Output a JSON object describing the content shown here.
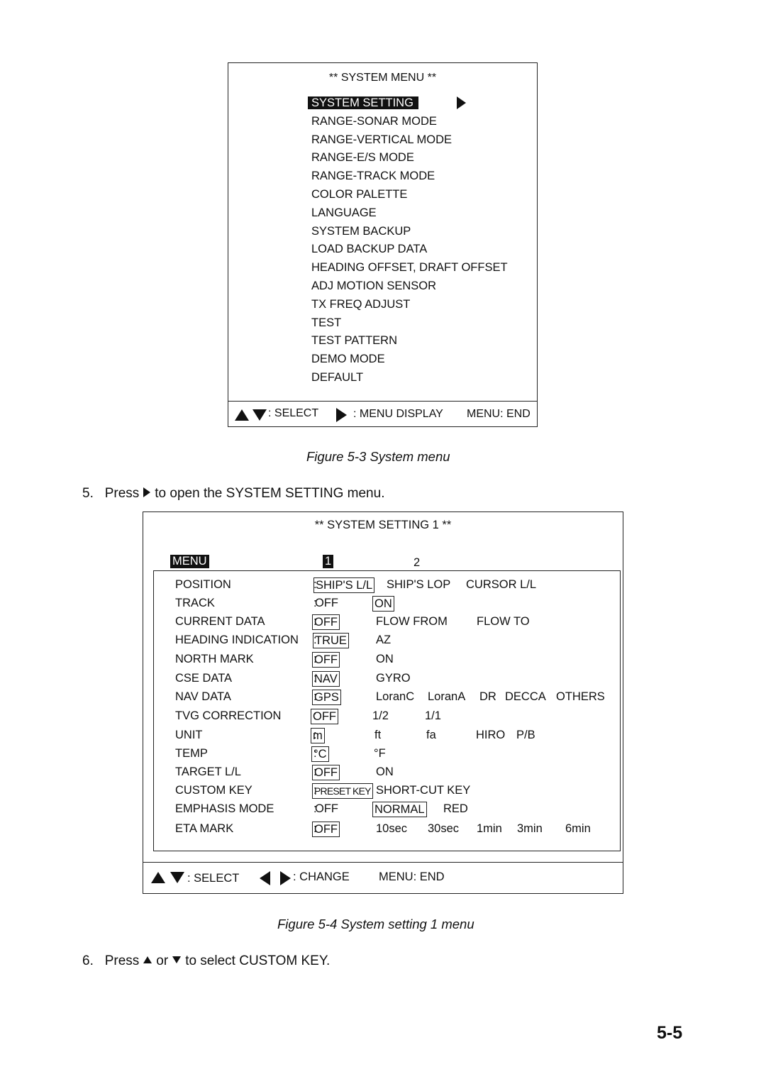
{
  "figure_5_3": {
    "title": "** SYSTEM MENU **",
    "items": [
      {
        "label": "SYSTEM SETTING",
        "selected": true
      },
      {
        "label": "RANGE-SONAR MODE"
      },
      {
        "label": "RANGE-VERTICAL MODE"
      },
      {
        "label": "RANGE-E/S MODE"
      },
      {
        "label": "RANGE-TRACK MODE"
      },
      {
        "label": "COLOR PALETTE"
      },
      {
        "label": "LANGUAGE"
      },
      {
        "label": "SYSTEM BACKUP"
      },
      {
        "label": "LOAD BACKUP DATA"
      },
      {
        "label": "HEADING OFFSET, DRAFT OFFSET"
      },
      {
        "label": "ADJ MOTION SENSOR"
      },
      {
        "label": "TX FREQ ADJUST"
      },
      {
        "label": "TEST"
      },
      {
        "label": "TEST PATTERN"
      },
      {
        "label": "DEMO MODE"
      },
      {
        "label": "DEFAULT"
      }
    ],
    "footer": {
      "select": ": SELECT",
      "menu_display": ": MENU DISPLAY",
      "menu_end": "MENU: END"
    },
    "caption": "Figure 5-3 System menu"
  },
  "step5": {
    "num": "5.",
    "pre": "Press",
    "post": "to open the SYSTEM SETTING menu."
  },
  "figure_5_4": {
    "title": "** SYSTEM SETTING 1 **",
    "tabs": {
      "menu": "MENU",
      "page1": "1",
      "page2": "2"
    },
    "rows": [
      {
        "label": "POSITION",
        "options": [
          "SHIP'S L/L",
          "SHIP'S LOP",
          "CURSOR L/L"
        ],
        "selected": 0
      },
      {
        "label": "TRACK",
        "options": [
          "OFF",
          "ON"
        ],
        "selected": 1
      },
      {
        "label": "CURRENT DATA",
        "options": [
          "OFF",
          "FLOW FROM",
          "FLOW TO"
        ],
        "selected": 0
      },
      {
        "label": "HEADING INDICATION",
        "options": [
          "TRUE",
          "AZ"
        ],
        "selected": 0
      },
      {
        "label": "NORTH MARK",
        "options": [
          "OFF",
          "ON"
        ],
        "selected": 0
      },
      {
        "label": "CSE DATA",
        "options": [
          "NAV",
          "GYRO"
        ],
        "selected": 0
      },
      {
        "label": "NAV DATA",
        "options": [
          "GPS",
          "LoranC",
          "LoranA",
          "DR",
          "DECCA",
          "OTHERS"
        ],
        "selected": 0
      },
      {
        "label": "TVG CORRECTION",
        "options": [
          "OFF",
          "1/2",
          "1/1"
        ],
        "selected": 0
      },
      {
        "label": "UNIT",
        "options": [
          "m",
          "ft",
          "fa",
          "HIRO",
          "P/B"
        ],
        "selected": 0
      },
      {
        "label": "TEMP",
        "options": [
          "°C",
          "°F"
        ],
        "selected": 0
      },
      {
        "label": "TARGET L/L",
        "options": [
          "OFF",
          "ON"
        ],
        "selected": 0
      },
      {
        "label": "CUSTOM KEY",
        "options": [
          "PRESET KEY",
          "SHORT-CUT KEY"
        ],
        "selected": 0
      },
      {
        "label": "EMPHASIS MODE",
        "options": [
          "OFF",
          "NORMAL",
          "RED"
        ],
        "selected": 1
      },
      {
        "label": "ETA MARK",
        "options": [
          "OFF",
          "10sec",
          "30sec",
          "1min",
          "3min",
          "6min"
        ],
        "selected": 0
      }
    ],
    "footer": {
      "select": ": SELECT",
      "change": ": CHANGE",
      "menu_end": "MENU: END"
    },
    "caption": "Figure 5-4 System setting 1 menu"
  },
  "step6": {
    "num": "6.",
    "pre": "Press",
    "mid": "or",
    "post": "to select CUSTOM KEY."
  },
  "page_number": "5-5"
}
